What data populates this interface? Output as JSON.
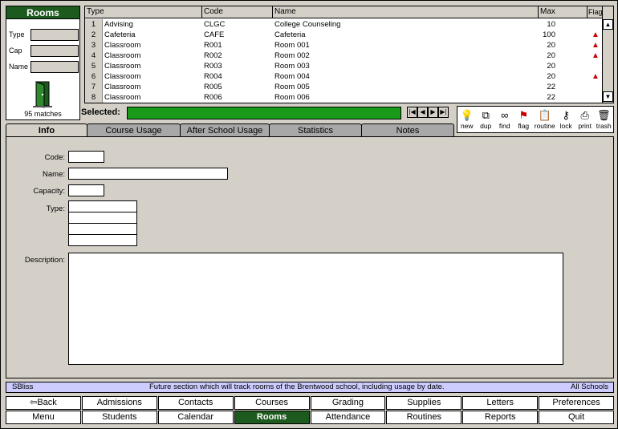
{
  "left_panel": {
    "title": "Rooms",
    "fields": [
      {
        "label": "Type"
      },
      {
        "label": "Cap"
      },
      {
        "label": "Name"
      }
    ],
    "matches": "95 matches"
  },
  "table": {
    "headers": {
      "type": "Type",
      "code": "Code",
      "name": "Name",
      "max": "Max",
      "flag": "Flag"
    },
    "rows": [
      {
        "num": "1",
        "type": "Advising",
        "code": "CLGC",
        "name": "College Counseling",
        "max": "10",
        "flag": ""
      },
      {
        "num": "2",
        "type": "Cafeteria",
        "code": "CAFE",
        "name": "Cafeteria",
        "max": "100",
        "flag": "▲"
      },
      {
        "num": "3",
        "type": "Classroom",
        "code": "R001",
        "name": "Room 001",
        "max": "20",
        "flag": "▲"
      },
      {
        "num": "4",
        "type": "Classroom",
        "code": "R002",
        "name": "Room 002",
        "max": "20",
        "flag": "▲"
      },
      {
        "num": "5",
        "type": "Classroom",
        "code": "R003",
        "name": "Room 003",
        "max": "20",
        "flag": ""
      },
      {
        "num": "6",
        "type": "Classroom",
        "code": "R004",
        "name": "Room 004",
        "max": "20",
        "flag": "▲"
      },
      {
        "num": "7",
        "type": "Classroom",
        "code": "R005",
        "name": "Room 005",
        "max": "22",
        "flag": ""
      },
      {
        "num": "8",
        "type": "Classroom",
        "code": "R006",
        "name": "Room 006",
        "max": "22",
        "flag": ""
      }
    ]
  },
  "selected_label": "Selected:",
  "toolbar": [
    {
      "label": "new",
      "icon": "lightbulb-icon",
      "glyph": "💡"
    },
    {
      "label": "dup",
      "icon": "duplicate-icon",
      "glyph": "⧉"
    },
    {
      "label": "find",
      "icon": "glasses-icon",
      "glyph": "∞"
    },
    {
      "label": "flag",
      "icon": "flag-icon",
      "glyph": "⚑"
    },
    {
      "label": "routine",
      "icon": "clipboard-icon",
      "glyph": "📋"
    },
    {
      "label": "lock",
      "icon": "key-icon",
      "glyph": "⚷"
    },
    {
      "label": "print",
      "icon": "printer-icon",
      "glyph": "⎙"
    },
    {
      "label": "trash",
      "icon": "trash-icon",
      "glyph": "🗑"
    }
  ],
  "tabs": [
    "Info",
    "Course Usage",
    "After School Usage",
    "Statistics",
    "Notes"
  ],
  "form": {
    "code_label": "Code:",
    "name_label": "Name:",
    "capacity_label": "Capacity:",
    "type_label": "Type:",
    "description_label": "Description:"
  },
  "status": {
    "left": "SBliss",
    "center": "Future section which will track rooms of the Brentwood school, including usage by date.",
    "right": "All Schools"
  },
  "nav_row1": [
    "Back",
    "Admissions",
    "Contacts",
    "Courses",
    "Grading",
    "Supplies",
    "Letters",
    "Preferences"
  ],
  "nav_row2": [
    "Menu",
    "Students",
    "Calendar",
    "Rooms",
    "Attendance",
    "Routines",
    "Reports",
    "Quit"
  ],
  "colors": {
    "accent": "#1d5a1d",
    "selected_bar": "#1a9a1a",
    "status_bg": "#ccccff",
    "flag": "#cc0000"
  }
}
